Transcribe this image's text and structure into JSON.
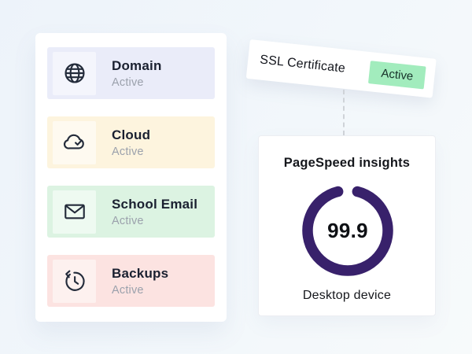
{
  "background": {
    "gradient_from": "#edf3fa",
    "gradient_to": "#f7fafb"
  },
  "services_card": {
    "items": [
      {
        "label": "Domain",
        "status": "Active",
        "icon": "globe-icon",
        "row_bg": "#eaecf9",
        "icon_bg": "#f4f5fc"
      },
      {
        "label": "Cloud",
        "status": "Active",
        "icon": "cloud-check-icon",
        "row_bg": "#fdf4de",
        "icon_bg": "#fefaf0"
      },
      {
        "label": "School Email",
        "status": "Active",
        "icon": "envelope-icon",
        "row_bg": "#dcf3e2",
        "icon_bg": "#eefaf1"
      },
      {
        "label": "Backups",
        "status": "Active",
        "icon": "history-icon",
        "row_bg": "#fce3e1",
        "icon_bg": "#fdf1ef"
      }
    ],
    "label_color": "#1a2030",
    "status_color": "#9ba1ac"
  },
  "ssl_card": {
    "label": "SSL Certificate",
    "badge_label": "Active",
    "badge_bg": "#a2ecbd",
    "badge_text_color": "#17322a"
  },
  "pagespeed_card": {
    "title": "PageSpeed insights",
    "score": "99.9",
    "device_label": "Desktop device",
    "ring_color": "#38216b"
  }
}
